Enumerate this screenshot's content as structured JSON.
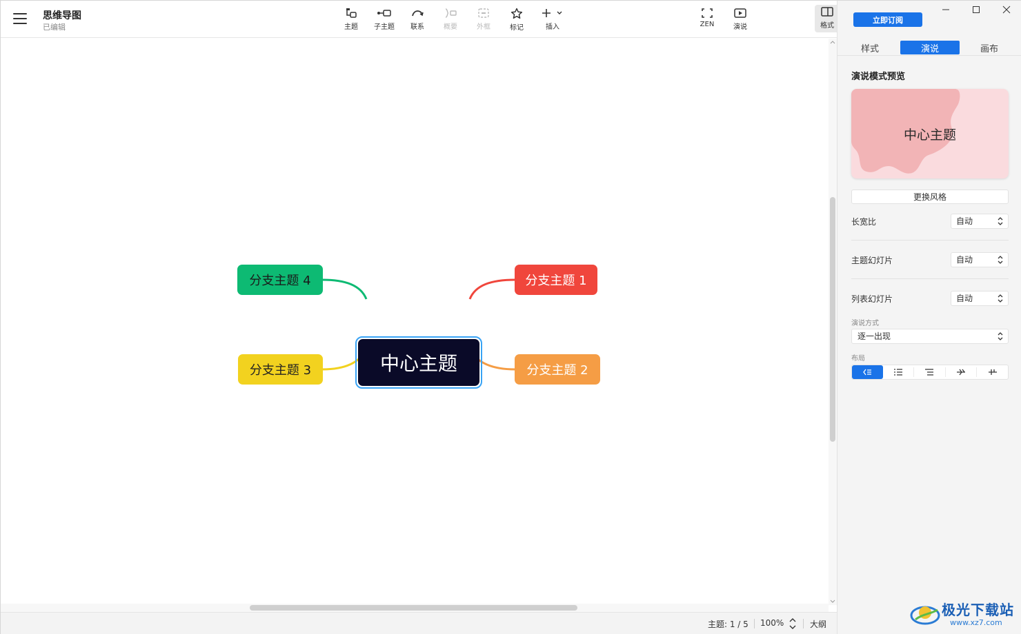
{
  "document": {
    "title": "思维导图",
    "status": "已编辑"
  },
  "toolbar": {
    "topic": "主题",
    "subtopic": "子主题",
    "relation": "联系",
    "summary": "概要",
    "boundary": "外框",
    "marker": "标记",
    "insert": "插入",
    "zen": "ZEN",
    "present": "演说",
    "format": "格式"
  },
  "mindmap": {
    "central": "中心主题",
    "branches": [
      {
        "label": "分支主题 1",
        "color": "#f0463c"
      },
      {
        "label": "分支主题 2",
        "color": "#f59d45"
      },
      {
        "label": "分支主题 3",
        "color": "#f2d21f"
      },
      {
        "label": "分支主题 4",
        "color": "#0dba73"
      }
    ],
    "central_color": "#0a0a28",
    "selection_color": "#39a3f5"
  },
  "statusbar": {
    "topic_count": "主题: 1 / 5",
    "zoom": "100%",
    "outline": "大纲"
  },
  "panel": {
    "subscribe": "立即订阅",
    "tabs": [
      "样式",
      "演说",
      "画布"
    ],
    "active_tab": "演说",
    "preview_title": "演说模式预览",
    "preview_center": "中心主题",
    "change_style": "更换风格",
    "aspect_label": "长宽比",
    "aspect_value": "自动",
    "topic_slide_label": "主题幻灯片",
    "topic_slide_value": "自动",
    "list_slide_label": "列表幻灯片",
    "list_slide_value": "自动",
    "mode_label": "演说方式",
    "mode_value": "逐一出现",
    "layout_label": "布局",
    "accent": "#1a73e8"
  },
  "watermark": {
    "name": "极光下载站",
    "url": "www.xz7.com"
  }
}
